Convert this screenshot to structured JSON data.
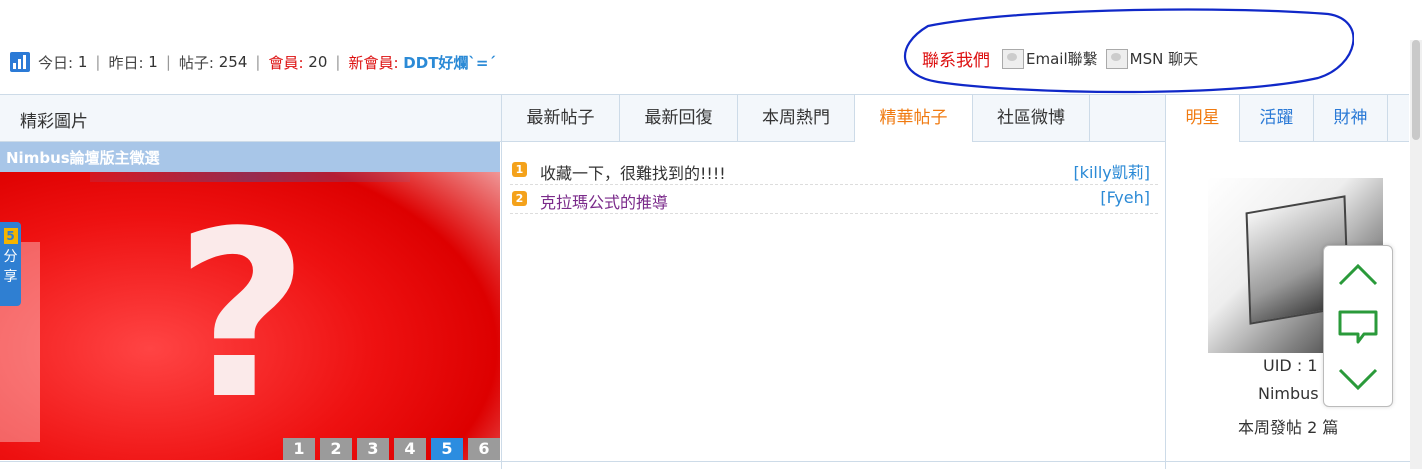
{
  "stats": {
    "today_label": "今日:",
    "today_value": "1",
    "yesterday_label": "昨日:",
    "yesterday_value": "1",
    "posts_label": "帖子:",
    "posts_value": "254",
    "members_label": "會員:",
    "members_value": "20",
    "new_member_label": "新會員:",
    "new_member_value": "DDT好爛ˋ=ˊ",
    "separator": "|"
  },
  "contact": {
    "title": "聯系我們",
    "email_label": "Email聯繫",
    "msn_label": "MSN 聊天"
  },
  "colors": {
    "accent_blue": "#2b8ad6",
    "accent_orange": "#f07a10",
    "accent_red": "#dd1111",
    "border": "#cddbe8",
    "annotation_circle": "#1028c8"
  },
  "left": {
    "title": "精彩圖片",
    "slide_caption": "Nimbus論壇版主徵選",
    "pager": [
      "1",
      "2",
      "3",
      "4",
      "5",
      "6"
    ],
    "pager_active": "5"
  },
  "share": {
    "badge": "5",
    "line1": "分",
    "line2": "享"
  },
  "tabs": [
    "最新帖子",
    "最新回復",
    "本周熱門",
    "精華帖子",
    "社區微博"
  ],
  "active_tab": "精華帖子",
  "threads": [
    {
      "num": "1",
      "title": "收藏一下，很難找到的!!!!",
      "author": "[killy凱莉]"
    },
    {
      "num": "2",
      "title": "克拉瑪公式的推導",
      "author": "[Fyeh]"
    }
  ],
  "right": {
    "tabs": [
      "明星",
      "活躍",
      "財神"
    ],
    "active_tab": "明星",
    "uid_text": "UID : 1",
    "name": "Nimbus",
    "posts_text": "本周發帖 2 篇"
  },
  "float_nav": {
    "icons": [
      "chevron-up-icon",
      "comment-icon",
      "chevron-down-icon"
    ]
  }
}
